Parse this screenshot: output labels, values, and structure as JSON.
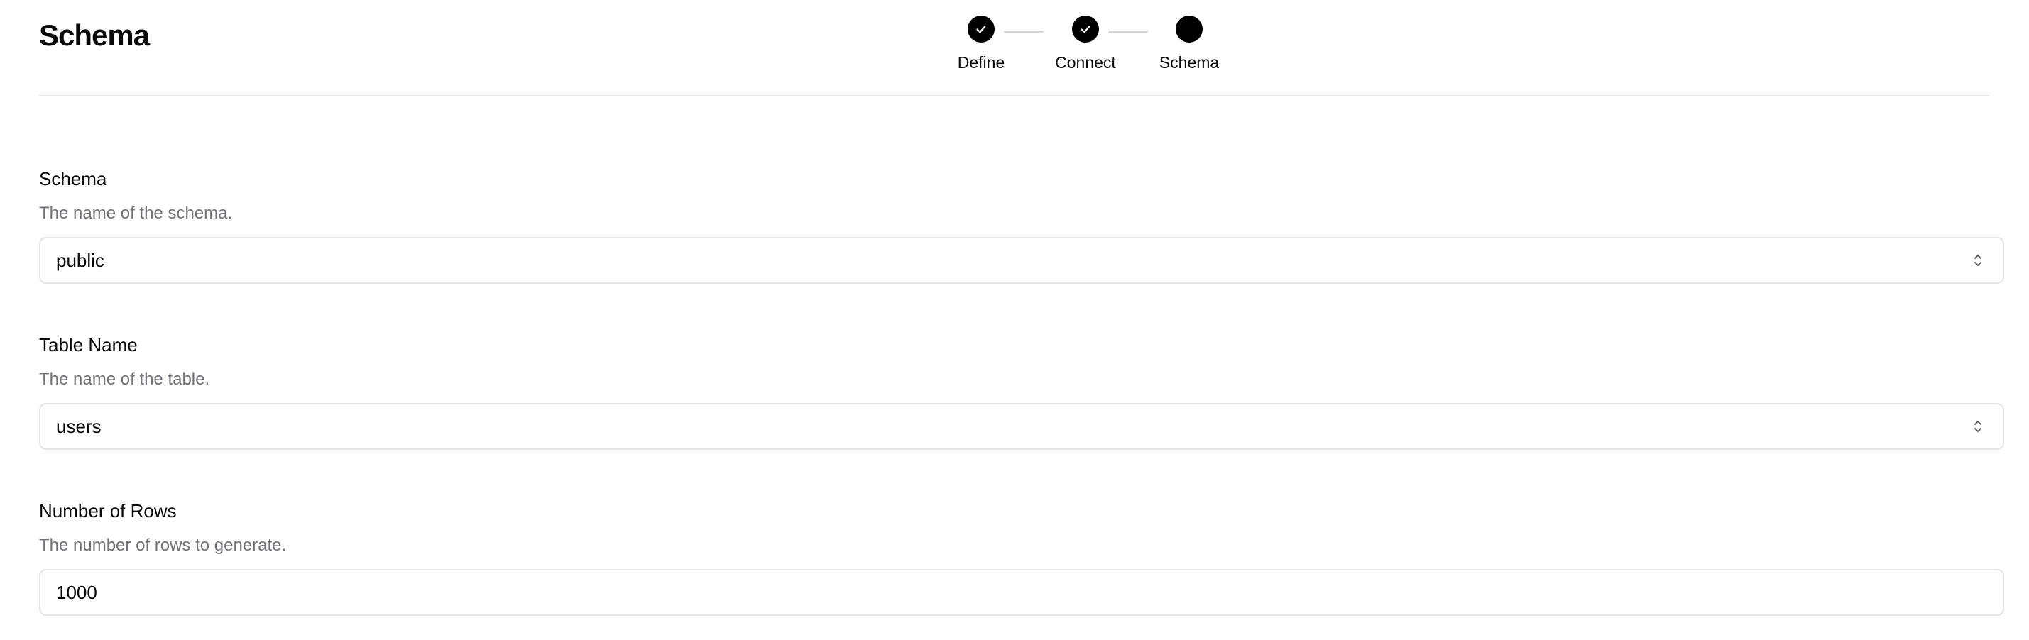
{
  "header": {
    "title": "Schema"
  },
  "stepper": {
    "steps": [
      {
        "label": "Define",
        "status": "completed",
        "icon": "check-icon"
      },
      {
        "label": "Connect",
        "status": "completed",
        "icon": "check-icon"
      },
      {
        "label": "Schema",
        "status": "current",
        "icon": ""
      }
    ]
  },
  "form": {
    "schema": {
      "label": "Schema",
      "description": "The name of the schema.",
      "value": "public",
      "icon": "chevron-up-down-icon"
    },
    "table_name": {
      "label": "Table Name",
      "description": "The name of the table.",
      "value": "users",
      "icon": "chevron-up-down-icon"
    },
    "row_count": {
      "label": "Number of Rows",
      "description": "The number of rows to generate.",
      "value": "1000"
    }
  },
  "colors": {
    "step_active": "#000000",
    "connector": "#d4d4d8",
    "border": "#e4e4e7",
    "muted_text": "#71717a"
  }
}
